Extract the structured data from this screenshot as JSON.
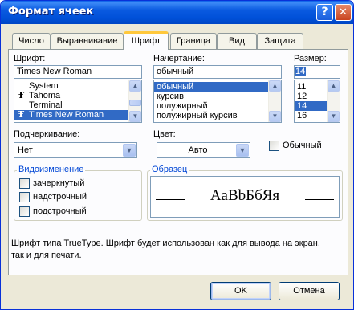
{
  "window": {
    "title": "Формат ячеек",
    "help_glyph": "?",
    "close_glyph": "✕"
  },
  "tabs": [
    {
      "label": "Число",
      "active": false
    },
    {
      "label": "Выравнивание",
      "active": false
    },
    {
      "label": "Шрифт",
      "active": true
    },
    {
      "label": "Граница",
      "active": false
    },
    {
      "label": "Вид",
      "active": false
    },
    {
      "label": "Защита",
      "active": false
    }
  ],
  "font": {
    "label": "Шрифт:",
    "value": "Times New Roman",
    "items": [
      {
        "label": "System",
        "truetype": false,
        "selected": false
      },
      {
        "label": "Tahoma",
        "truetype": true,
        "selected": false
      },
      {
        "label": "Terminal",
        "truetype": false,
        "selected": false
      },
      {
        "label": "Times New Roman",
        "truetype": true,
        "selected": true
      }
    ]
  },
  "style": {
    "label": "Начертание:",
    "value": "обычный",
    "items": [
      {
        "label": "обычный",
        "selected": true
      },
      {
        "label": "курсив",
        "selected": false
      },
      {
        "label": "полужирный",
        "selected": false
      },
      {
        "label": "полужирный курсив",
        "selected": false
      }
    ]
  },
  "size": {
    "label": "Размер:",
    "value": "14",
    "items": [
      {
        "label": "11",
        "selected": false
      },
      {
        "label": "12",
        "selected": false
      },
      {
        "label": "14",
        "selected": true
      },
      {
        "label": "16",
        "selected": false
      }
    ]
  },
  "underline": {
    "label": "Подчеркивание:",
    "value": "Нет"
  },
  "color": {
    "label": "Цвет:",
    "value": "Авто"
  },
  "normal_font": {
    "label": "Обычный",
    "checked": false
  },
  "effects": {
    "title": "Видоизменение",
    "items": [
      {
        "label": "зачеркнутый",
        "checked": false
      },
      {
        "label": "надстрочный",
        "checked": false
      },
      {
        "label": "подстрочный",
        "checked": false
      }
    ]
  },
  "preview": {
    "title": "Образец",
    "sample": "AaBbБбЯя"
  },
  "description": {
    "line1": "Шрифт типа TrueType. Шрифт будет использован как для вывода на экран,",
    "line2": "так и для печати."
  },
  "buttons": {
    "ok": "OK",
    "cancel": "Отмена"
  },
  "icons": {
    "truetype": "truetype-icon",
    "scroll_up": "▲",
    "scroll_down": "▼",
    "dropdown": "▼"
  },
  "colors": {
    "title_bar": "#0054e3",
    "selection": "#316ac5",
    "group_title": "#0046d5",
    "active_tab_accent": "#ffc83c"
  }
}
